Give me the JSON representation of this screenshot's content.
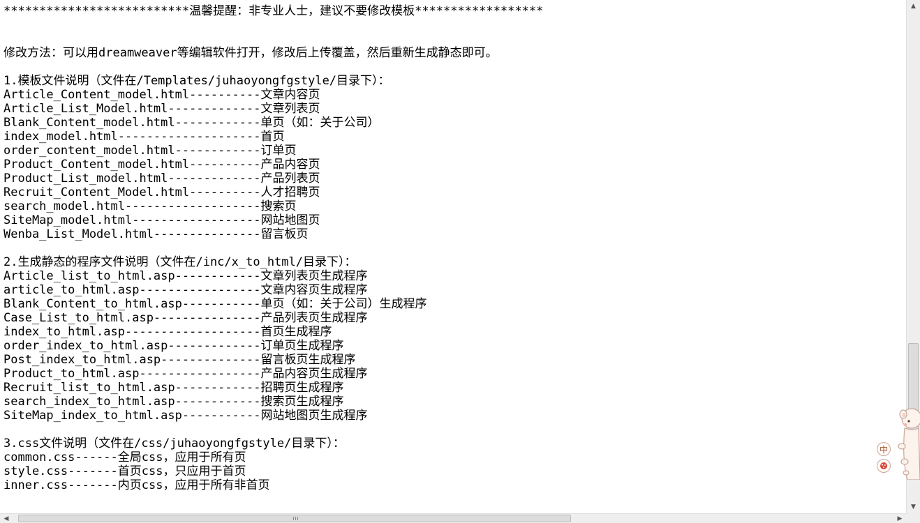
{
  "document": {
    "lines": [
      "**************************温馨提醒：非专业人士，建议不要修改模板******************",
      "",
      "",
      "修改方法：可以用dreamweaver等编辑软件打开，修改后上传覆盖，然后重新生成静态即可。",
      "",
      "1.模板文件说明（文件在/Templates/juhaoyongfgstyle/目录下）：",
      "Article_Content_model.html----------文章内容页",
      "Article_List_Model.html-------------文章列表页",
      "Blank_Content_model.html------------单页（如：关于公司）",
      "index_model.html--------------------首页",
      "order_content_model.html------------订单页",
      "Product_Content_model.html----------产品内容页",
      "Product_List_model.html-------------产品列表页",
      "Recruit_Content_Model.html----------人才招聘页",
      "search_model.html-------------------搜索页",
      "SiteMap_model.html------------------网站地图页",
      "Wenba_List_Model.html---------------留言板页",
      "",
      "2.生成静态的程序文件说明（文件在/inc/x_to_html/目录下）：",
      "Article_list_to_html.asp------------文章列表页生成程序",
      "article_to_html.asp-----------------文章内容页生成程序",
      "Blank_Content_to_html.asp-----------单页（如：关于公司）生成程序",
      "Case_List_to_html.asp---------------产品列表页生成程序",
      "index_to_html.asp-------------------首页生成程序",
      "order_index_to_html.asp-------------订单页生成程序",
      "Post_index_to_html.asp--------------留言板页生成程序",
      "Product_to_html.asp-----------------产品内容页生成程序",
      "Recruit_list_to_html.asp------------招聘页生成程序",
      "search_index_to_html.asp------------搜索页生成程序",
      "SiteMap_index_to_html.asp-----------网站地图页生成程序",
      "",
      "3.css文件说明（文件在/css/juhaoyongfgstyle/目录下）：",
      "common.css------全局css，应用于所有页",
      "style.css-------首页css，只应用于首页",
      "inner.css-------内页css，应用于所有非首页"
    ]
  },
  "ime": {
    "language_label": "中",
    "skin_icon": "ime-skin-icon",
    "mascot_icon": "mascot-icon"
  },
  "scrollbars": {
    "up_arrow": "▲",
    "down_arrow": "▼",
    "left_arrow": "◀",
    "right_arrow": "▶"
  }
}
